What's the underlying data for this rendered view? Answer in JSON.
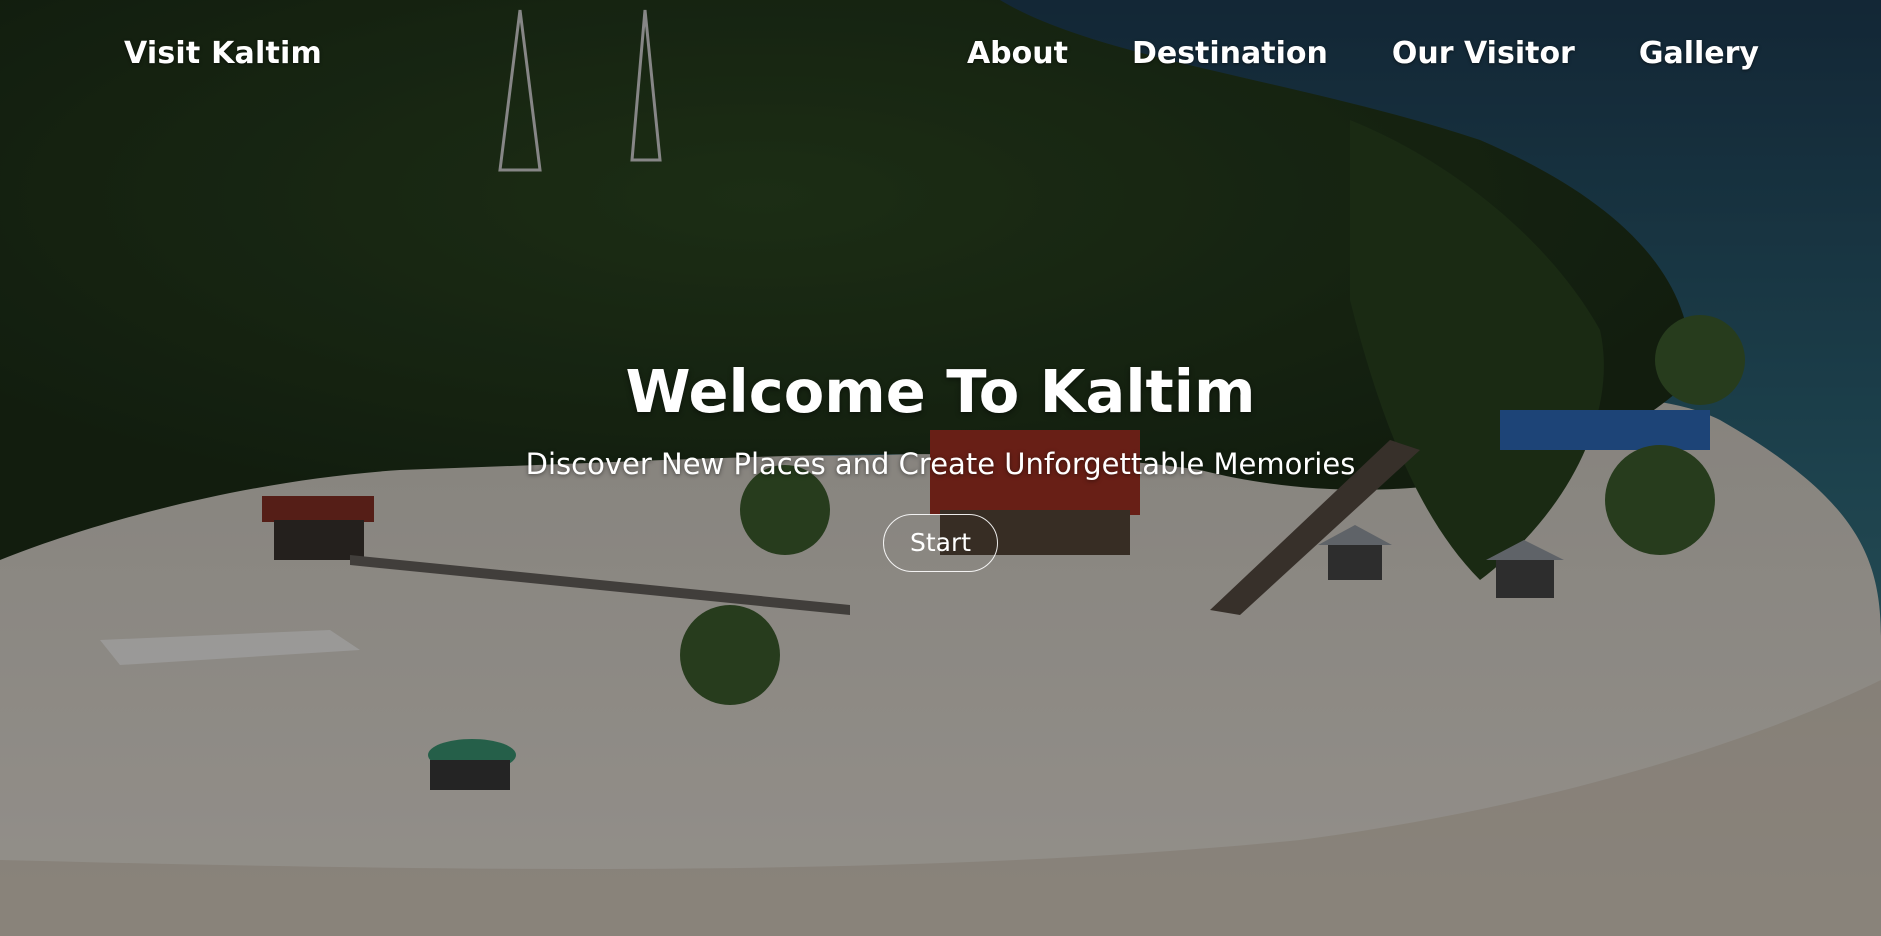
{
  "navbar": {
    "brand": "Visit Kaltim",
    "links": [
      "About",
      "Destination",
      "Our Visitor",
      "Gallery"
    ]
  },
  "hero": {
    "title": "Welcome To Kaltim",
    "subtitle": "Discover New Places and Create Unforgettable Memories",
    "button_label": "Start",
    "background_description_icon": "tropical-beach-image"
  },
  "colors": {
    "text": "#ffffff",
    "overlay": "rgba(0,0,0,0.38)",
    "sea": "#2f5b6e",
    "sand": "#e7e2da",
    "palm": "#2e4a22"
  }
}
